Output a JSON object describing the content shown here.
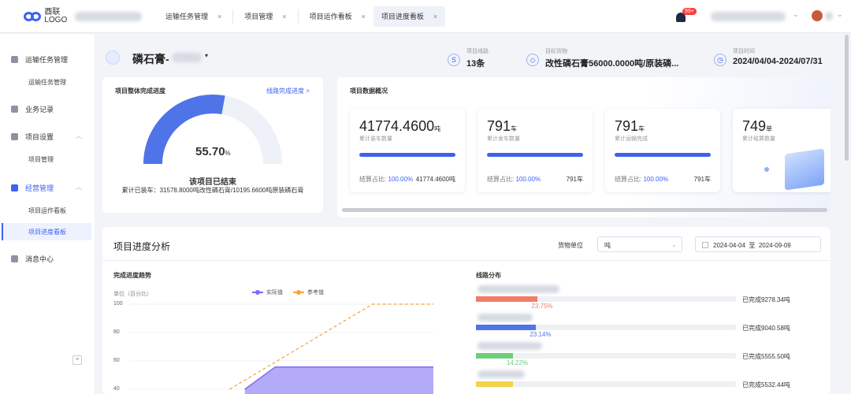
{
  "app": {
    "logo_text": "酉联\nLOGO"
  },
  "tabs": [
    {
      "label": "运输任务管理",
      "close": "×"
    },
    {
      "label": "项目管理",
      "close": "×"
    },
    {
      "label": "项目运作看板",
      "close": "×"
    },
    {
      "label": "项目进度看板",
      "close": "×",
      "active": true
    }
  ],
  "notifications": {
    "badge": "99+"
  },
  "sidebar": {
    "items": [
      {
        "label": "运输任务管理",
        "icon": "truck-icon"
      },
      {
        "label": "运输任务管理",
        "sub": true
      },
      {
        "label": "业务记录",
        "icon": "car-icon"
      },
      {
        "label": "项目设置",
        "icon": "grid-icon"
      },
      {
        "label": "项目管理",
        "sub": true
      },
      {
        "label": "经营管理",
        "icon": "bar-chart-icon"
      },
      {
        "label": "项目运作看板",
        "sub": true
      },
      {
        "label": "项目进度看板",
        "sub": true,
        "active": true
      },
      {
        "label": "消息中心",
        "icon": "bell-icon"
      }
    ],
    "collapse_icon": "collapse-icon"
  },
  "project": {
    "name": "磷石膏-",
    "stats": [
      {
        "label": "项目线路",
        "value": "13条",
        "icon": "route-icon"
      },
      {
        "label": "目标货物",
        "value": "改性磷石膏56000.0000吨/原装磷...",
        "icon": "cube-icon"
      },
      {
        "label": "项目时间",
        "value": "2024/04/04-2024/07/31",
        "icon": "clock-icon"
      }
    ]
  },
  "progress": {
    "title": "项目整体完成进度",
    "link": "线路完成进度 >",
    "percent_value": "55.70",
    "percent_unit": "%",
    "percent": 55.7,
    "status": "该项目已结束",
    "desc": "累计已装车：31578.8000吨改性磷石膏/10195.6600吨原装磷石膏"
  },
  "overview": {
    "title": "项目数据概况",
    "cards": [
      {
        "value": "41774.4600",
        "unit": "吨",
        "label": "累计装车数量",
        "ratio_label": "结算占比:",
        "ratio": "100.00%",
        "right": "41774.4600吨"
      },
      {
        "value": "791",
        "unit": "车",
        "label": "累计发车数量",
        "ratio_label": "结算占比:",
        "ratio": "100.00%",
        "right": "791车"
      },
      {
        "value": "791",
        "unit": "车",
        "label": "累计运输完成",
        "ratio_label": "结算占比:",
        "ratio": "100.00%",
        "right": "791车"
      },
      {
        "value": "749",
        "unit": "单",
        "label": "累计结算数量"
      }
    ]
  },
  "analysis": {
    "title": "项目进度分析",
    "unit_label": "货物单位",
    "unit_value": "吨",
    "date_from": "2024-04-04",
    "date_sep": "至",
    "date_to": "2024-09-09"
  },
  "trend": {
    "title": "完成进度趋势",
    "unit_label": "单位（百分比）",
    "legend": [
      {
        "name": "实际值",
        "color": "#7b6cf6"
      },
      {
        "name": "参考值",
        "color": "#f5a33c"
      }
    ],
    "y_ticks": [
      "100",
      "80",
      "60",
      "40"
    ]
  },
  "chart_data": {
    "type": "area",
    "title": "完成进度趋势",
    "ylabel": "单位（百分比）",
    "ylim": [
      40,
      100
    ],
    "series": [
      {
        "name": "实际值",
        "color": "#7b6cf6",
        "points": [
          [
            0.38,
            40
          ],
          [
            0.48,
            55.7
          ],
          [
            1.0,
            55.7
          ]
        ]
      },
      {
        "name": "参考值",
        "color": "#f5a33c",
        "points": [
          [
            0.33,
            40
          ],
          [
            0.8,
            100
          ],
          [
            1.0,
            100
          ]
        ]
      }
    ]
  },
  "distribution": {
    "title": "线路分布",
    "items": [
      {
        "percent_text": "23.75%",
        "percent": 23.75,
        "color": "#f07d6a",
        "done": "已完成9278.34吨"
      },
      {
        "percent_text": "23.14%",
        "percent": 23.14,
        "color": "#4f74e8",
        "done": "已完成9040.58吨"
      },
      {
        "percent_text": "14.22%",
        "percent": 14.22,
        "color": "#6ccf7a",
        "done": "已完成5555.50吨"
      },
      {
        "percent_text": "",
        "percent": 14.16,
        "color": "#f2d34a",
        "done": "已完成5532.44吨"
      }
    ]
  }
}
